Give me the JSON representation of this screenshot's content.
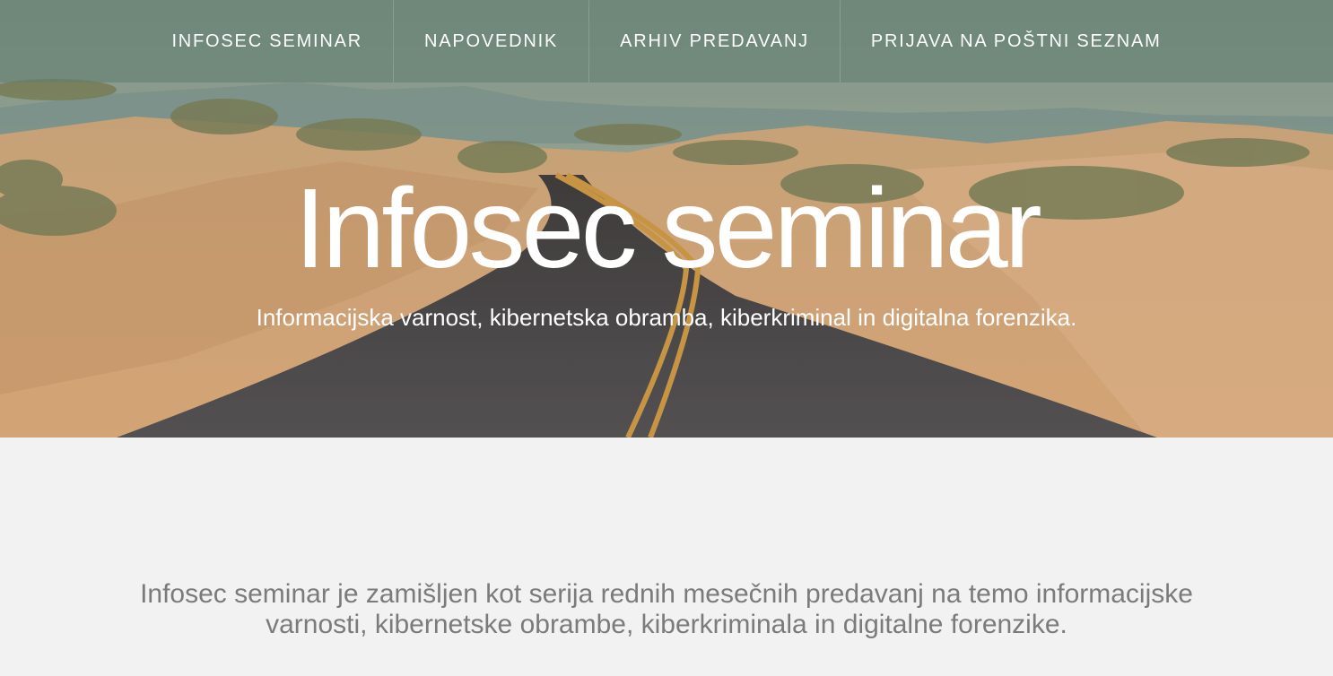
{
  "nav": {
    "items": [
      {
        "label": "INFOSEC SEMINAR"
      },
      {
        "label": "NAPOVEDNIK"
      },
      {
        "label": "ARHIV PREDAVANJ"
      },
      {
        "label": "PRIJAVA NA POŠTNI SEZNAM"
      }
    ]
  },
  "hero": {
    "title": "Infosec seminar",
    "subtitle": "Informacijska varnost, kibernetska obramba, kiberkriminal in digitalna forenzika."
  },
  "intro": {
    "text": "Infosec seminar je zamišljen kot serija rednih mesečnih predavanj na temo informacijske varnosti, kibernetske obrambe, kiberkriminala in digitalne forenzike."
  },
  "colors": {
    "page_background": "#f2f2f2",
    "sky": "#8fa9a0",
    "sand": "#d9a978",
    "road": "#3f4349",
    "road_line": "#c9963e",
    "intro_text": "#7b7b7b"
  }
}
